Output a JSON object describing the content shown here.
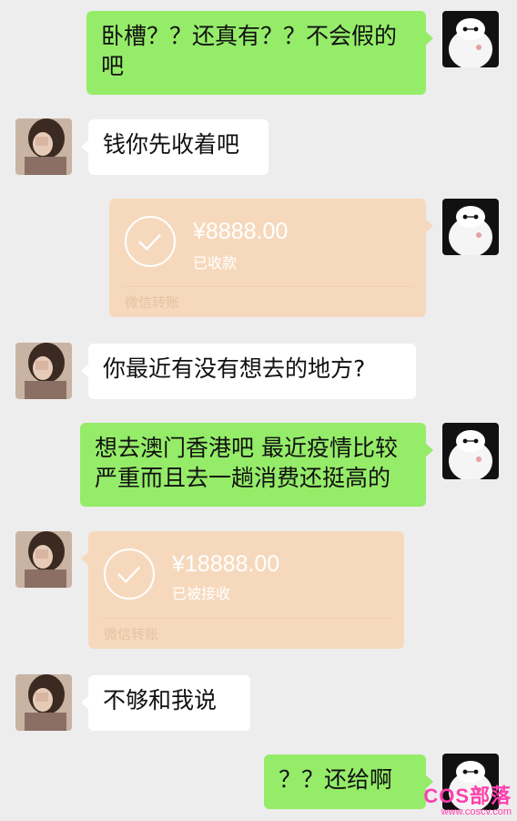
{
  "messages": [
    {
      "side": "right",
      "type": "text",
      "text": "卧槽？？还真有？？不会假的吧"
    },
    {
      "side": "left",
      "type": "text",
      "text": "钱你先收着吧"
    },
    {
      "side": "right",
      "type": "transfer",
      "amount": "¥8888.00",
      "status": "已收款",
      "footer": "微信转账"
    },
    {
      "side": "left",
      "type": "text",
      "text": "你最近有没有想去的地方?"
    },
    {
      "side": "right",
      "type": "text",
      "text": "想去澳门香港吧 最近疫情比较严重而且去一趟消费还挺高的"
    },
    {
      "side": "left",
      "type": "transfer",
      "amount": "¥18888.00",
      "status": "已被接收",
      "footer": "微信转账"
    },
    {
      "side": "left",
      "type": "text",
      "text": "不够和我说"
    },
    {
      "side": "right",
      "type": "text",
      "text": "？？还给啊"
    }
  ],
  "colors": {
    "background": "#ededed",
    "bubble_self": "#95ec69",
    "bubble_other": "#ffffff",
    "transfer_card": "#f6d9bd",
    "watermark": "#ff3fae"
  },
  "avatars": {
    "self": "baymax-avatar",
    "other": "girl-photo-avatar"
  },
  "watermark": {
    "logo": "COS部落",
    "url": "www.coscv.com"
  }
}
